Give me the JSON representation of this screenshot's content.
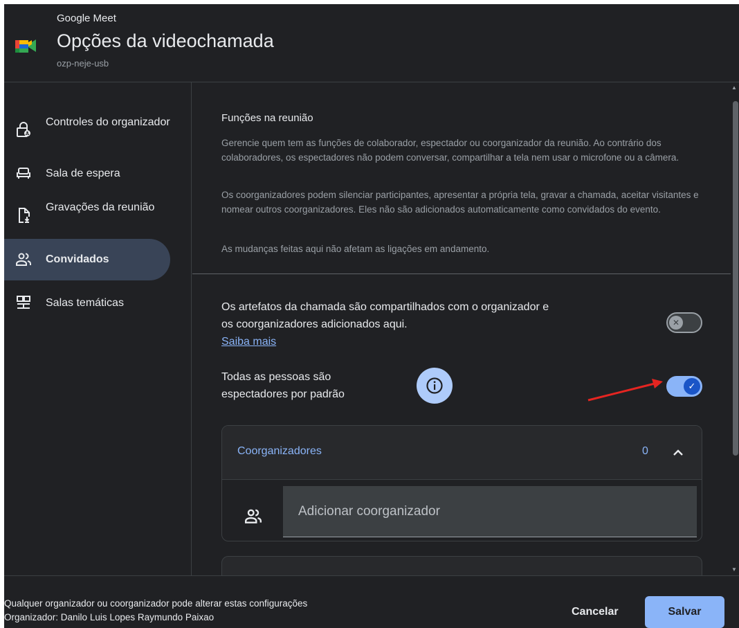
{
  "header": {
    "app_name": "Google Meet",
    "title": "Opções da videochamada",
    "meeting_code": "ozp-neje-usb"
  },
  "sidebar": {
    "items": [
      {
        "label": "Controles do organizador",
        "icon": "lock-person-icon",
        "active": false
      },
      {
        "label": "Sala de espera",
        "icon": "chair-icon",
        "active": false
      },
      {
        "label": "Gravações da reunião",
        "icon": "file-download-icon",
        "active": false
      },
      {
        "label": "Convidados",
        "icon": "people-icon",
        "active": true
      },
      {
        "label": "Salas temáticas",
        "icon": "breakout-rooms-icon",
        "active": false
      }
    ]
  },
  "roles": {
    "title": "Funções na reunião",
    "description_1": "Gerencie quem tem as funções de colaborador, espectador ou coorganizador da reunião. Ao contrário dos colaboradores, os espectadores não podem conversar, compartilhar a tela nem usar o microfone ou a câmera.",
    "description_2": "Os coorganizadores podem silenciar participantes, apresentar a própria tela, gravar a chamada, aceitar visitantes e nomear outros coorganizadores. Eles não são adicionados automaticamente como convidados do evento.",
    "description_3": "As mudanças feitas aqui não afetam as ligações em andamento."
  },
  "artifacts": {
    "text": "Os artefatos da chamada são compartilhados com o organizador e os coorganizadores adicionados aqui.",
    "learn_more": "Saiba mais",
    "toggle_on": false
  },
  "viewers": {
    "text": "Todas as pessoas são espectadores por padrão",
    "toggle_on": true
  },
  "cohosts": {
    "title": "Coorganizadores",
    "count": "0",
    "input_placeholder": "Adicionar coorganizador"
  },
  "footer": {
    "note": "Qualquer organizador ou coorganizador pode alterar estas configurações",
    "organizer": "Organizador: Danilo Luis Lopes Raymundo Paixao",
    "cancel_label": "Cancelar",
    "save_label": "Salvar"
  },
  "colors": {
    "background": "#202124",
    "accent": "#8ab4f8",
    "active_nav": "#394457",
    "annotation_arrow": "#e52521"
  }
}
